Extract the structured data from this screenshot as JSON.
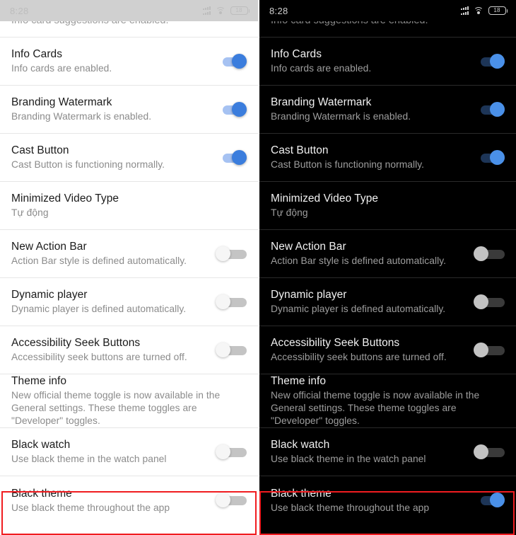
{
  "statusbar": {
    "time": "8:28",
    "signal_icon": "signal-bars-icon",
    "wifi_icon": "wifi-icon",
    "battery_icon": "battery-icon",
    "battery_level": "18"
  },
  "cutoff_row": {
    "text": "Info card suggestions are enabled."
  },
  "highlight_color": "#f01c20",
  "accent_on_light": "#3b7ddd",
  "accent_on_dark": "#4a90e8",
  "panels": [
    {
      "name": "light-theme-screen",
      "theme": "light"
    },
    {
      "name": "dark-theme-screen",
      "theme": "dark"
    }
  ],
  "rows": [
    {
      "title": "Info Cards",
      "subtitle": "Info cards are enabled.",
      "toggle_light": "on",
      "toggle_dark": "on"
    },
    {
      "title": "Branding Watermark",
      "subtitle": "Branding Watermark is enabled.",
      "toggle_light": "on",
      "toggle_dark": "on"
    },
    {
      "title": "Cast Button",
      "subtitle": "Cast Button is functioning normally.",
      "toggle_light": "on",
      "toggle_dark": "on"
    },
    {
      "title": "Minimized Video Type",
      "subtitle": "Tự động",
      "toggle_light": "none",
      "toggle_dark": "none"
    },
    {
      "title": "New Action Bar",
      "subtitle": "Action Bar style is defined automatically.",
      "toggle_light": "off",
      "toggle_dark": "off"
    },
    {
      "title": "Dynamic player",
      "subtitle": "Dynamic player is defined automatically.",
      "toggle_light": "off",
      "toggle_dark": "off"
    },
    {
      "title": "Accessibility Seek Buttons",
      "subtitle": "Accessibility seek buttons are turned off.",
      "toggle_light": "off",
      "toggle_dark": "off"
    },
    {
      "title": "Theme info",
      "subtitle": "New official theme toggle is now available in the General settings. These theme toggles are \"Developer\" toggles.",
      "toggle_light": "none",
      "toggle_dark": "none"
    },
    {
      "title": "Black watch",
      "subtitle": "Use black theme in the watch panel",
      "toggle_light": "off",
      "toggle_dark": "off"
    },
    {
      "title": "Black theme",
      "subtitle": "Use black theme throughout the app",
      "toggle_light": "off",
      "toggle_dark": "on",
      "highlighted": true
    }
  ]
}
